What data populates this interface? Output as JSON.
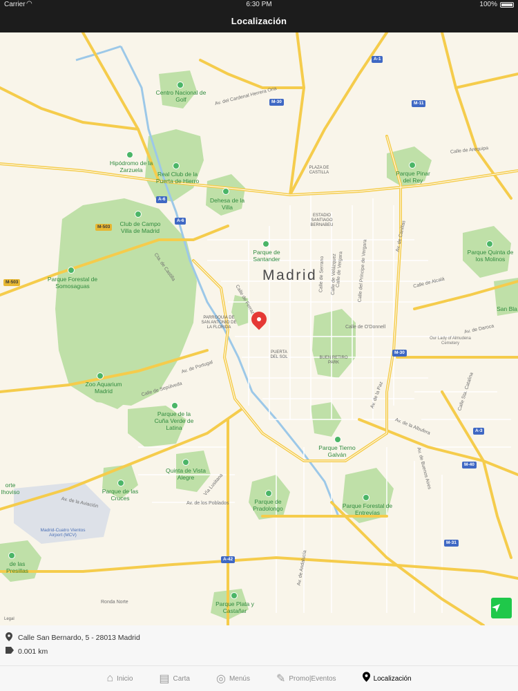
{
  "status_bar": {
    "carrier": "Carrier",
    "time": "6:30 PM",
    "battery": "100%"
  },
  "nav": {
    "title": "Localización"
  },
  "map": {
    "city": "Madrid",
    "green_labels": [
      "Centro Nacional de Golf",
      "Hipódromo de la Zarzuela",
      "Real Club de la Puerta de Hierro",
      "Dehesa de la Villa",
      "Club de Campo Villa de Madrid",
      "Parque Forestal de Somosaguas",
      "Parque de Santander",
      "Parque Pinar del Rey",
      "Parque Quinta de los Molinos",
      "Zoo Aquarium Madrid",
      "Parque de la Cuña Verde de Latina",
      "Quinta de Vista Alegre",
      "Parque de las Cruces",
      "Parque de Pradolongo",
      "Parque Tierno Galván",
      "Parque Forestal de Entrevías",
      "Parque Plata y Castañar",
      "de las Presillas",
      "San Bla",
      "orte Ihoviso"
    ],
    "poi_labels": [
      "PLAZA DE CASTILLA",
      "ESTADIO SANTIAGO BERNABEU",
      "PARROQUIA DE SAN ANTONIO DE LA FLORIDA",
      "PUERTA DEL SOL",
      "BUEN RETIRO PARK",
      "Our Lady of Almudena Cemetery",
      "Madrid-Cuatro Vientos Airport (MCV)"
    ],
    "street_labels": [
      "Av. del Cardenal Herrera Oria",
      "Calle de Arequipa",
      "Calle de Alcalá",
      "Calle de O'Donnell",
      "Av. de Daroca",
      "Av. de Portugal",
      "Calle de Sepúlveda",
      "Av. de la Aviación",
      "Av. de los Poblados",
      "Vía Lusitana",
      "Ronda Norte",
      "Av. de Andalucía",
      "Av. de la Albufera",
      "Av. de Buenos Aires",
      "Av. de la Paz",
      "Calle de Ferraz",
      "Calle de Vergara",
      "Calle del Príncipe de Vergara",
      "Calle de Serrano",
      "Calle de Velázquez",
      "Calle Sta. Catalina",
      "Cta. de Castilla",
      "Av. de Canillas"
    ],
    "highway_shields": [
      "A-1",
      "M-30",
      "M-11",
      "A-6",
      "A-6",
      "M-503",
      "M-503",
      "M-30",
      "A-3",
      "M-40",
      "M-31",
      "A-42",
      "M-30",
      "A-2"
    ],
    "legal": "Legal",
    "colors": {
      "road_major": "#f5cc4c",
      "park": "#bfe0a8",
      "background": "#f9f5ea",
      "water": "#9cc8e8",
      "pin": "#e53935",
      "locate_button": "#1fc84a"
    }
  },
  "info": {
    "address": "Calle San Bernardo, 5 - 28013 Madrid",
    "distance": "0.001 km",
    "address_icon": "map-pin-icon",
    "distance_icon": "tag-icon"
  },
  "tabs": [
    {
      "label": "Inicio",
      "icon": "home-icon"
    },
    {
      "label": "Carta",
      "icon": "menu-card-icon"
    },
    {
      "label": "Menús",
      "icon": "dish-icon"
    },
    {
      "label": "Promo|Eventos",
      "icon": "tag-promo-icon"
    },
    {
      "label": "Localización",
      "icon": "location-pin-icon",
      "active": true
    }
  ]
}
